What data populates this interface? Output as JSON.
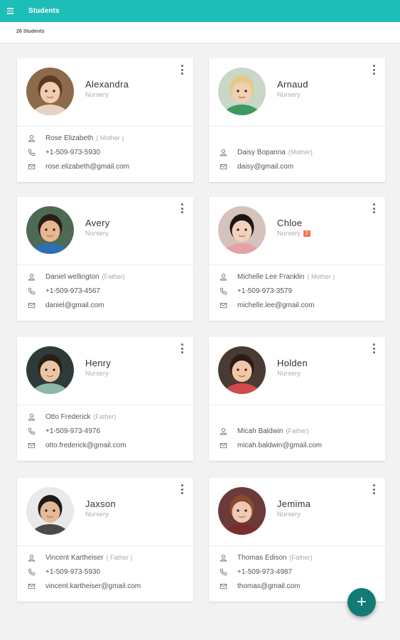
{
  "appbar": {
    "title": "Students"
  },
  "summary": {
    "count": "26 Students"
  },
  "students": [
    {
      "name": "Alexandra",
      "grade": "Nursery",
      "badge": "",
      "parent_name": "Rose Elizabeth",
      "relation": "( Mother )",
      "phone": "+1-509-973-5930",
      "email": "rose.elizabeth@gmail.com",
      "avatar": {
        "bg": "#8c6a4a",
        "face": "#f3cbb0",
        "hair": "#5a3a22",
        "shirt": "#e6d3c4"
      }
    },
    {
      "name": "Arnaud",
      "grade": "Nursery",
      "badge": "",
      "parent_name": "Daisy Bopanna",
      "relation": "(Mother)",
      "phone": "",
      "email": "daisy@gmail.com",
      "avatar": {
        "bg": "#c8d7c6",
        "face": "#f2cfb2",
        "hair": "#e4c98a",
        "shirt": "#3a9a62"
      }
    },
    {
      "name": "Avery",
      "grade": "Nursery",
      "badge": "",
      "parent_name": "Daniel wellington",
      "relation": "(Father)",
      "phone": "+1-509-973-4567",
      "email": "daniel@gmail.com",
      "avatar": {
        "bg": "#4e6a55",
        "face": "#e6b791",
        "hair": "#2a1e15",
        "shirt": "#2d6fb0"
      }
    },
    {
      "name": "Chloe",
      "grade": "Nursery",
      "badge": "2",
      "parent_name": "Michelle Lee Franklin",
      "relation": "( Mother )",
      "phone": "+1-509-973-3579",
      "email": "michelle.lee@gmail.com",
      "avatar": {
        "bg": "#d4c2bc",
        "face": "#f1d2be",
        "hair": "#1d1512",
        "shirt": "#e7a0a8"
      }
    },
    {
      "name": "Henry",
      "grade": "Nursery",
      "badge": "",
      "parent_name": "Otto Frederick",
      "relation": "(Father)",
      "phone": "+1-509-973-4976",
      "email": "otto.frederick@gmail.com",
      "avatar": {
        "bg": "#2f3b3a",
        "face": "#e9c6a6",
        "hair": "#2a1f17",
        "shirt": "#8fb7a8"
      }
    },
    {
      "name": "Holden",
      "grade": "Nursery",
      "badge": "",
      "parent_name": "Micah Baldwin",
      "relation": "(Father)",
      "phone": "",
      "email": "micah.baldwin@gmail.com",
      "avatar": {
        "bg": "#4a3a34",
        "face": "#f1c7a8",
        "hair": "#2b1d16",
        "shirt": "#cf4a4a"
      }
    },
    {
      "name": "Jaxson",
      "grade": "Nursery",
      "badge": "",
      "parent_name": "Vincent Kartheiser",
      "relation": "( Father )",
      "phone": "+1-509-973-5930",
      "email": "vincent.kartheiser@gmail.com",
      "avatar": {
        "bg": "#e9e9e9",
        "face": "#e4b999",
        "hair": "#1f1a17",
        "shirt": "#4a4a4a"
      }
    },
    {
      "name": "Jemima",
      "grade": "Nursery",
      "badge": "",
      "parent_name": "Thomas Edison",
      "relation": "(Father)",
      "phone": "+1-509-973-4987",
      "email": "thomas@gmail.com",
      "avatar": {
        "bg": "#6b3a3a",
        "face": "#f0c9b4",
        "hair": "#8a4a2e",
        "shirt": "#7a2c2c"
      }
    }
  ],
  "fab": {
    "label": "+"
  }
}
